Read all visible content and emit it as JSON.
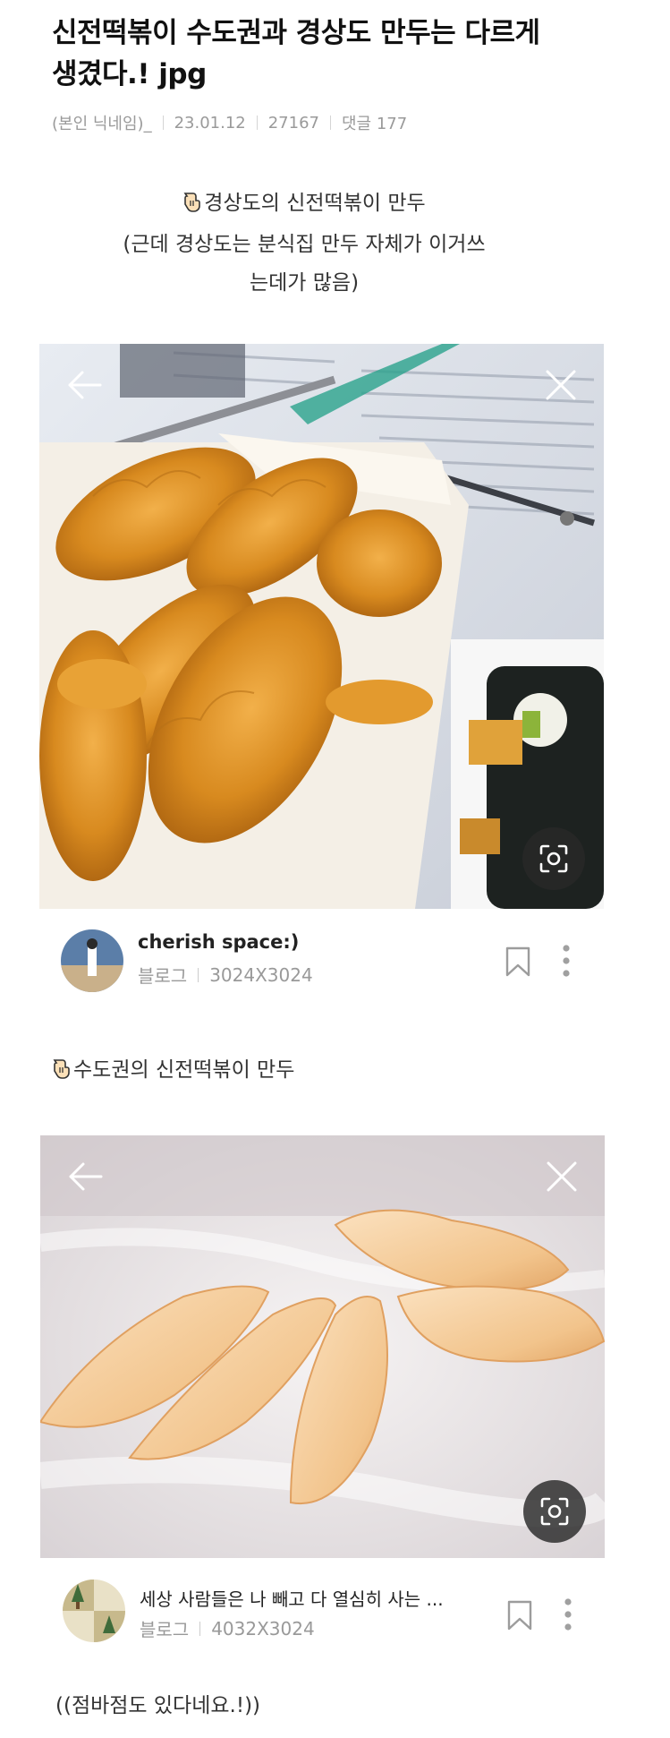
{
  "post": {
    "title": "신전떡볶이 수도권과 경상도 만두는 다르게 생겼다.! jpg",
    "author": "(본인 닉네임)_",
    "date": "23.01.12",
    "views": "27167",
    "comments": "댓글 177"
  },
  "section1": {
    "line1": "경상도의 신전떡볶이 만두",
    "line2": "(근데 경상도는 분식집 만두 자체가 이거쓰",
    "line3": "는데가 많음)"
  },
  "card1": {
    "name": "cherish space:)",
    "source": "블로그",
    "size": "3024X3024"
  },
  "section2": {
    "line1": "수도권의 신전떡볶이 만두"
  },
  "card2": {
    "name": "세상 사람들은 나 빼고 다 열심히 사는 ...",
    "source": "블로그",
    "size": "4032X3024"
  },
  "footer": {
    "text": "((점바점도 있다네요.!))"
  },
  "colors": {
    "meta": "#9a9a9a",
    "overlay": "#ffffff"
  },
  "icons": [
    "hand-pointing-down-icon",
    "back-arrow-icon",
    "close-icon",
    "lens-search-icon",
    "bookmark-icon",
    "more-vertical-icon"
  ]
}
